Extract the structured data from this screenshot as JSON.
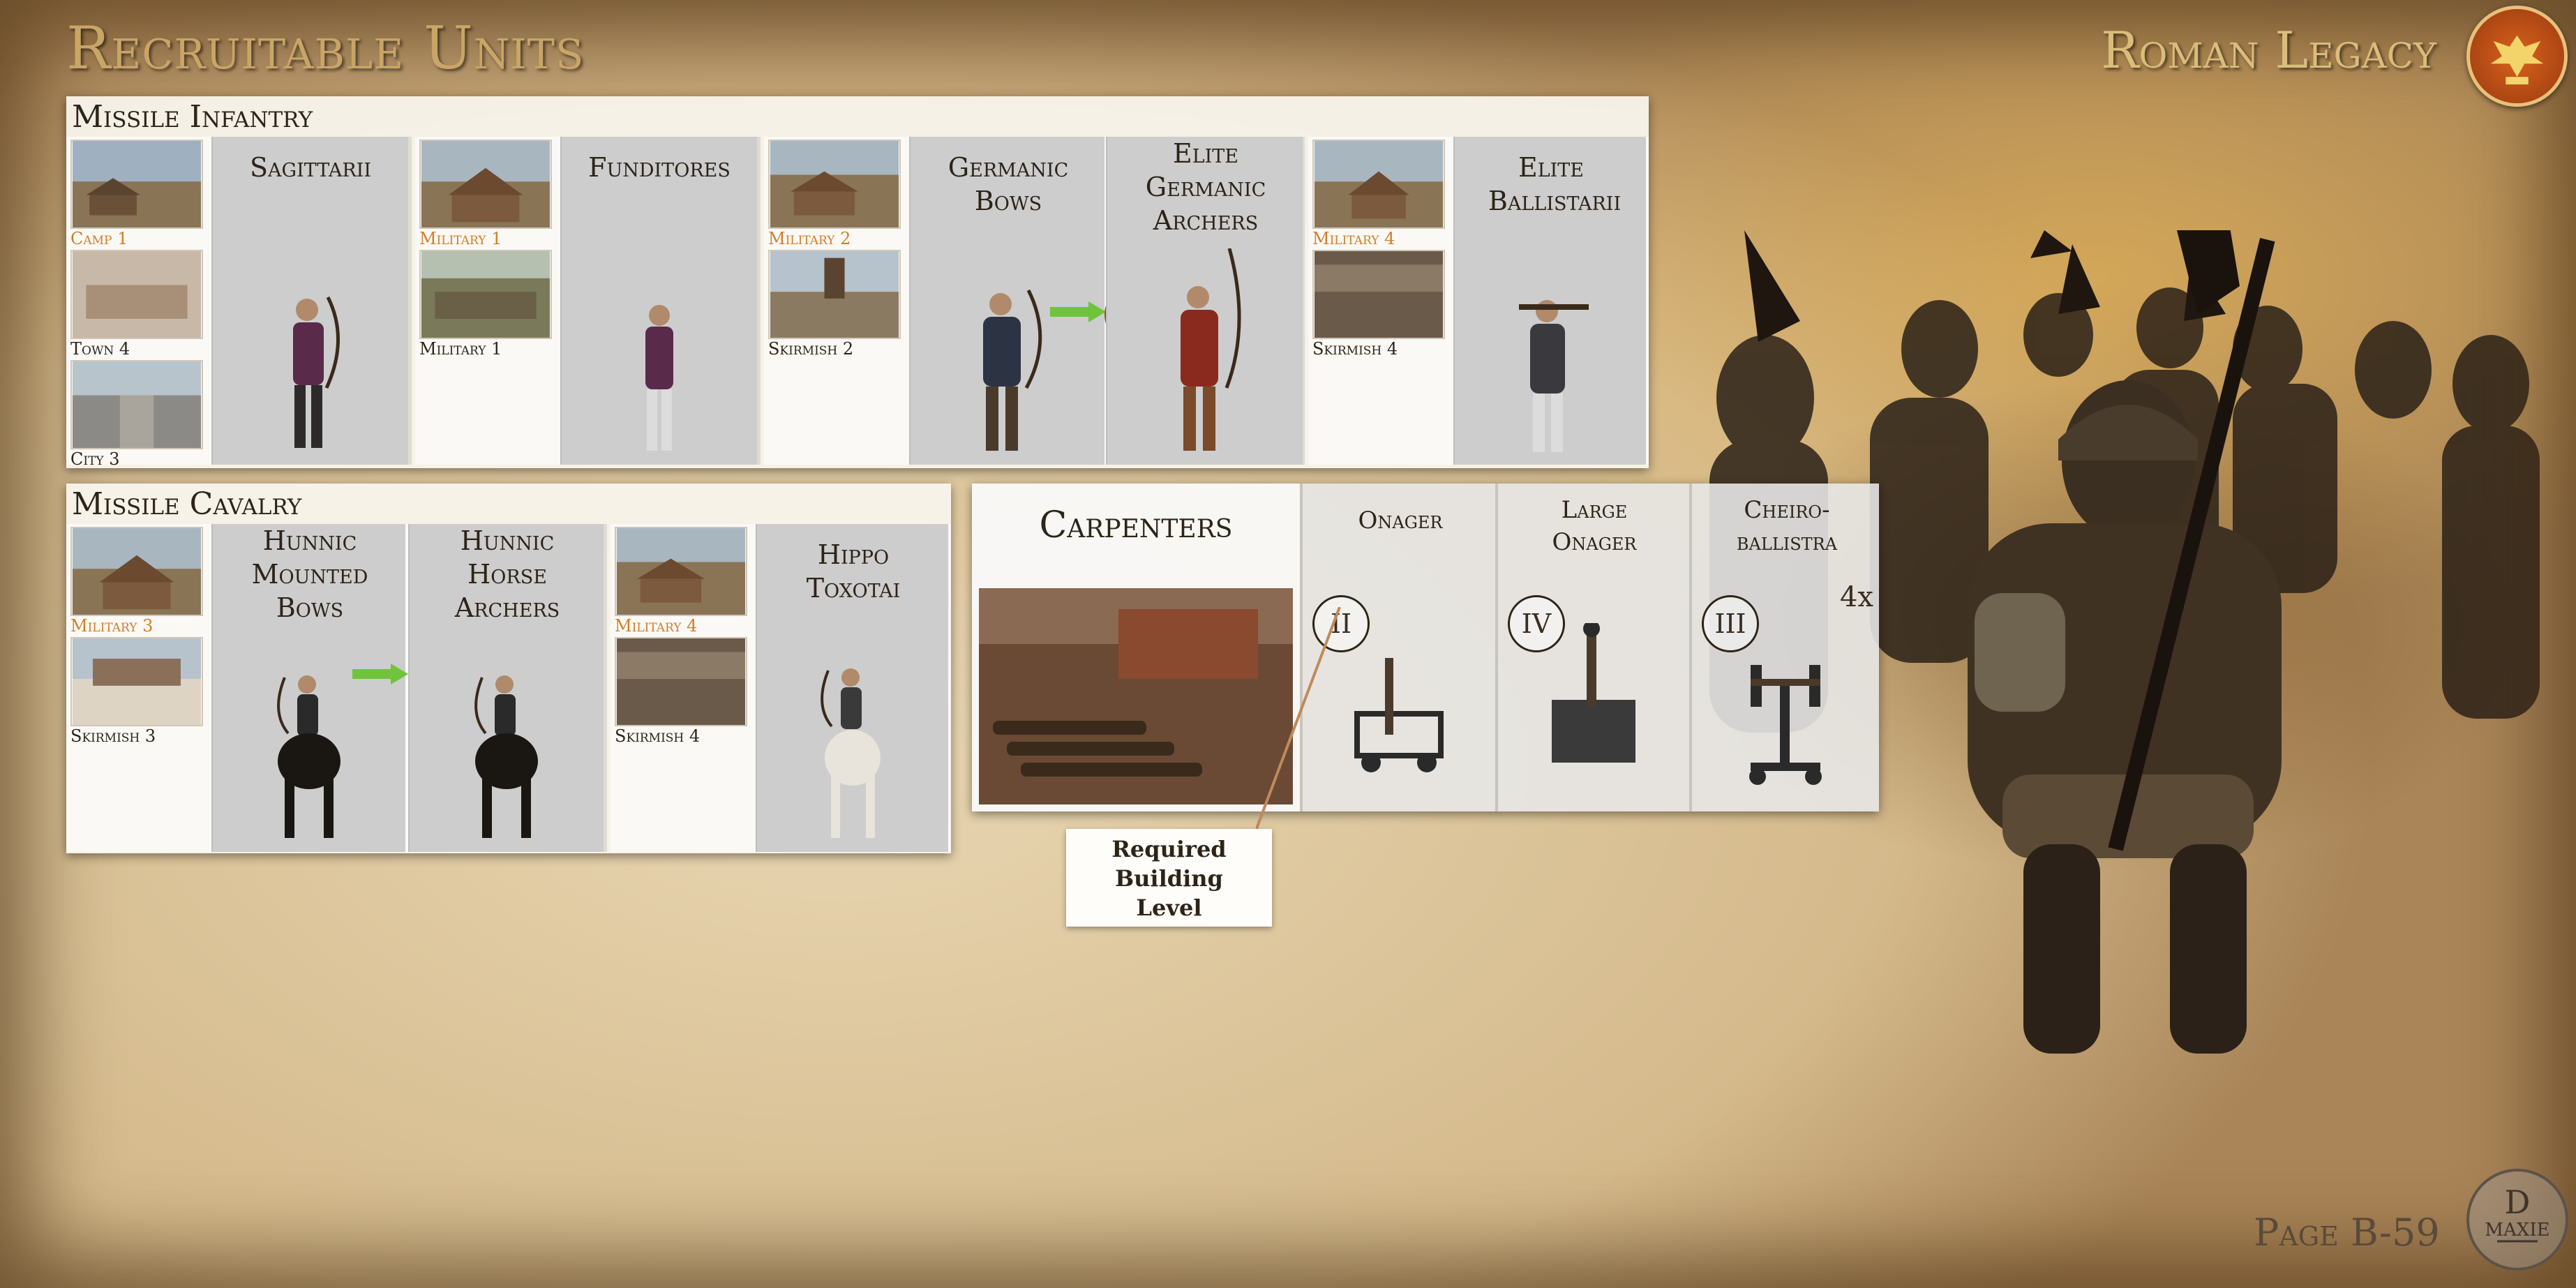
{
  "header": {
    "title": "Recruitable Units",
    "legacy": "Roman Legacy"
  },
  "missile_infantry": {
    "title": "Missile Infantry",
    "groups": [
      {
        "buildings": [
          {
            "label": "Camp 1",
            "highlight": true
          },
          {
            "label": "Town 4",
            "highlight": false
          },
          {
            "label": "City 3",
            "highlight": false
          }
        ],
        "units": [
          "Sagittarii"
        ]
      },
      {
        "buildings": [
          {
            "label": "Military 1",
            "highlight": true
          },
          {
            "label": "Military 1",
            "highlight": false
          }
        ],
        "units": [
          "Funditores"
        ]
      },
      {
        "buildings": [
          {
            "label": "Military 2",
            "highlight": true
          },
          {
            "label": "Skirmish 2",
            "highlight": false
          }
        ],
        "units": [
          "Germanic Bows",
          "Elite Germanic Archers"
        ]
      },
      {
        "buildings": [
          {
            "label": "Military 4",
            "highlight": true
          },
          {
            "label": "Skirmish 4",
            "highlight": false
          }
        ],
        "units": [
          "Elite Ballistarii"
        ]
      }
    ]
  },
  "missile_cavalry": {
    "title": "Missile Cavalry",
    "groups": [
      {
        "buildings": [
          {
            "label": "Military 3",
            "highlight": true
          },
          {
            "label": "Skirmish 3",
            "highlight": false
          }
        ],
        "units": [
          "Hunnic Mounted Bows",
          "Hunnic Horse Archers"
        ]
      },
      {
        "buildings": [
          {
            "label": "Military 4",
            "highlight": true
          },
          {
            "label": "Skirmish 4",
            "highlight": false
          }
        ],
        "units": [
          "Hippo Toxotai"
        ]
      }
    ]
  },
  "carpenters": {
    "title": "Carpenters",
    "engines": [
      {
        "name": "Onager",
        "level": "II",
        "count": ""
      },
      {
        "name": "Large Onager",
        "level": "IV",
        "count": ""
      },
      {
        "name": "Cheiro-ballistra",
        "level": "III",
        "count": "4x"
      }
    ]
  },
  "callout": {
    "line1": "Required",
    "line2": "Building",
    "line3": "Level"
  },
  "footer": {
    "page": "Page B-59",
    "logo_letters": "D MAXIE"
  },
  "colors": {
    "highlight": "#d47c24",
    "title_gold": "#c9a566",
    "arrow_green": "#6fc43b"
  }
}
